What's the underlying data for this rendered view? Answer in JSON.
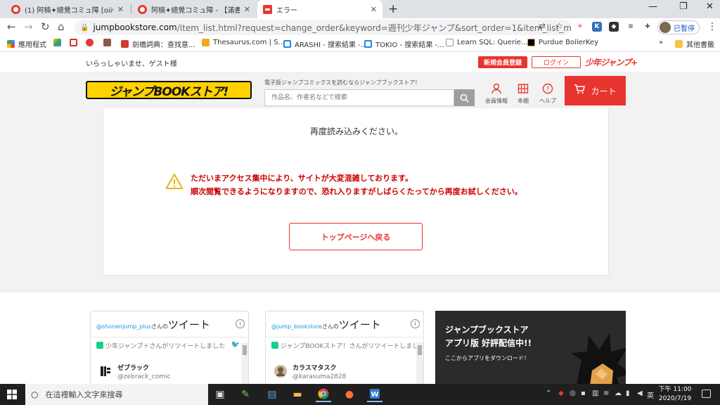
{
  "browser": {
    "tabs": [
      {
        "title": "(1) 阿楠✦總覺コミュ障 [oiiwa] · ",
        "active": false
      },
      {
        "title": "阿楠✦總覺コミュ障 - 【滿書推薦",
        "active": false
      },
      {
        "title": "エラー",
        "active": true
      }
    ],
    "url_host": "jumpbookstore.com",
    "url_path": "/item_list.html?request=change_order&keyword=週刊少年ジャンプ&sort_order=1&item_list_mode=1&...",
    "profile_label": "已暫停",
    "bookmarks": [
      "應用程式",
      "",
      "",
      "",
      "劍橋詞典：查找意...",
      "Thesaurus.com | S...",
      "ARASHI - 搜索結果 -...",
      "TOKIO - 搜索結果 -...",
      "Learn SQL: Querie...",
      "Purdue BoilerKey"
    ],
    "bookmarks_more": "»",
    "other_bookmarks": "其他書籤"
  },
  "site": {
    "welcome": "いらっしゃいませ、ゲスト様",
    "register_label": "新規会員登録",
    "login_label": "ログイン",
    "jumpplus_label": "少年ジャンプ+",
    "logo_text": "ジャンプBOOKストア!",
    "tagline": "電子版ジャンプコミックスを読むならジャンプブックストア!",
    "search_placeholder": "作品名、作者名などで検索",
    "nav": [
      {
        "label": "会員情報",
        "icon": "user-icon"
      },
      {
        "label": "本棚",
        "icon": "bookshelf-icon"
      },
      {
        "label": "ヘルプ",
        "icon": "help-icon"
      }
    ],
    "cart_label": "カート",
    "accent": "#e8342f"
  },
  "error": {
    "reload_text": "再度読み込みください。",
    "line1": "ただいまアクセス集中により、サイトが大変混雑しております。",
    "line2": "順次閲覧できるようになりますので、恐れ入りますがしばらくたってから再度お試しください。",
    "button_label": "トップページへ戻る"
  },
  "tweets": [
    {
      "account": "@shonenjump_plus",
      "suffix": "さんの",
      "title": "ツイート",
      "retweet": "少年ジャンプ＋さんがリツイートしました",
      "name": "ゼブラック",
      "handle": "@zebrack_comic"
    },
    {
      "account": "@jump_bookstore",
      "suffix": "さんの",
      "title": "ツイート",
      "retweet": "ジャンプBOOKストア！さんがリツイートしました",
      "name": "カラスマタスク",
      "handle": "@karasuma2828"
    }
  ],
  "app_banner": {
    "line1": "ジャンプブックストア",
    "line2": "アプリ版 好評配信中!!",
    "line3": "ここからアプリをダウンロード！"
  },
  "taskbar": {
    "search_placeholder": "在這裡輸入文字來搜尋",
    "time": "下午 11:00",
    "date": "2020/7/19"
  }
}
